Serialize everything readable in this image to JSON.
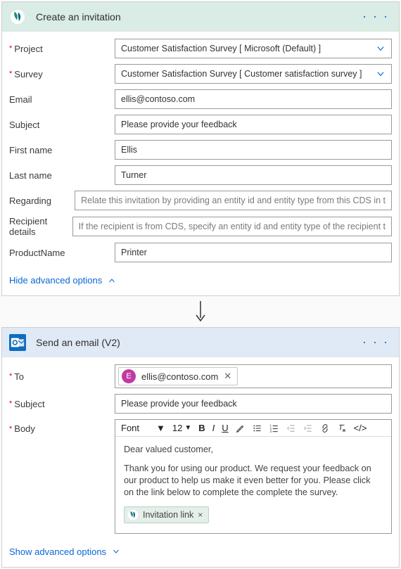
{
  "card1": {
    "title": "Create an invitation",
    "advanced_label": "Hide advanced options",
    "fields": {
      "project": {
        "label": "Project",
        "required": true,
        "type": "select",
        "value": "Customer Satisfaction Survey [ Microsoft (Default) ]"
      },
      "survey": {
        "label": "Survey",
        "required": true,
        "type": "select",
        "value": "Customer Satisfaction Survey [ Customer satisfaction survey ]"
      },
      "email": {
        "label": "Email",
        "required": false,
        "type": "text",
        "value": "ellis@contoso.com"
      },
      "subject": {
        "label": "Subject",
        "required": false,
        "type": "text",
        "value": "Please provide your feedback"
      },
      "firstname": {
        "label": "First name",
        "required": false,
        "type": "text",
        "value": "Ellis"
      },
      "lastname": {
        "label": "Last name",
        "required": false,
        "type": "text",
        "value": "Turner"
      },
      "regarding": {
        "label": "Regarding",
        "required": false,
        "type": "placeholder",
        "value": "Relate this invitation by providing an entity id and entity type from this CDS in t"
      },
      "recipient": {
        "label": "Recipient details",
        "required": false,
        "type": "placeholder",
        "value": "If the recipient is from CDS, specify an entity id and entity type of the recipient t"
      },
      "product": {
        "label": "ProductName",
        "required": false,
        "type": "text",
        "value": "Printer"
      }
    }
  },
  "card2": {
    "title": "Send an email (V2)",
    "advanced_label": "Show advanced options",
    "to": {
      "label": "To",
      "chip_initial": "E",
      "chip_text": "ellis@contoso.com"
    },
    "subject": {
      "label": "Subject",
      "value": "Please provide your feedback"
    },
    "body": {
      "label": "Body",
      "font_label": "Font",
      "size_label": "12",
      "p1": "Dear valued customer,",
      "p2": "Thank you for using our product. We request your feedback on our product to help us make it even better for you. Please click on the link below to complete the complete the survey.",
      "token": "Invitation link"
    }
  }
}
